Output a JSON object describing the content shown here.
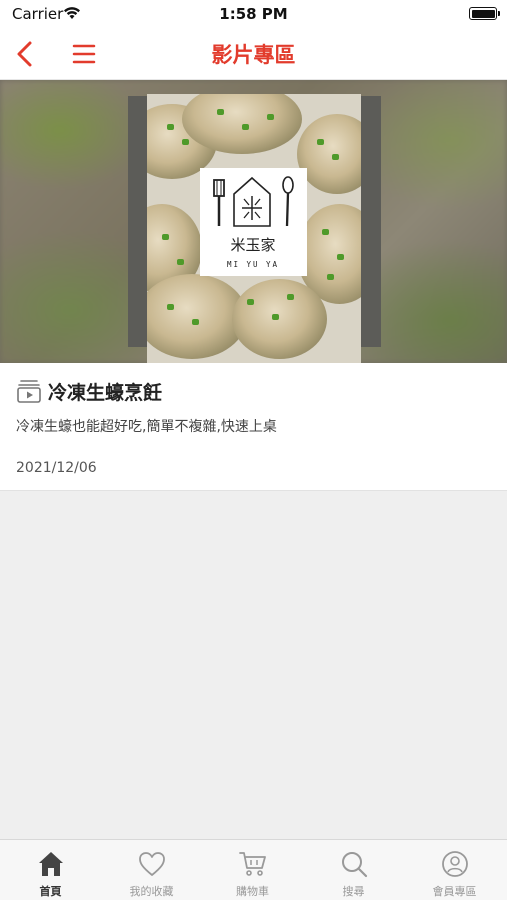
{
  "status_bar": {
    "carrier": "Carrier",
    "time": "1:58 PM"
  },
  "nav": {
    "title": "影片專區"
  },
  "video": {
    "title": "冷凍生蠔烹飪",
    "description": "冷凍生蠔也能超好吃,簡單不複雜,快速上桌",
    "date": "2021/12/06",
    "logo_text": "米玉家",
    "logo_romanized": "MI YU YA"
  },
  "tabs": [
    {
      "label": "首頁",
      "icon": "home-icon",
      "active": true
    },
    {
      "label": "我的收藏",
      "icon": "heart-icon",
      "active": false
    },
    {
      "label": "購物車",
      "icon": "cart-icon",
      "active": false
    },
    {
      "label": "搜尋",
      "icon": "search-icon",
      "active": false
    },
    {
      "label": "會員專區",
      "icon": "user-icon",
      "active": false
    }
  ],
  "colors": {
    "accent": "#e23b2c",
    "tab_active": "#333333",
    "tab_inactive": "#999999"
  }
}
